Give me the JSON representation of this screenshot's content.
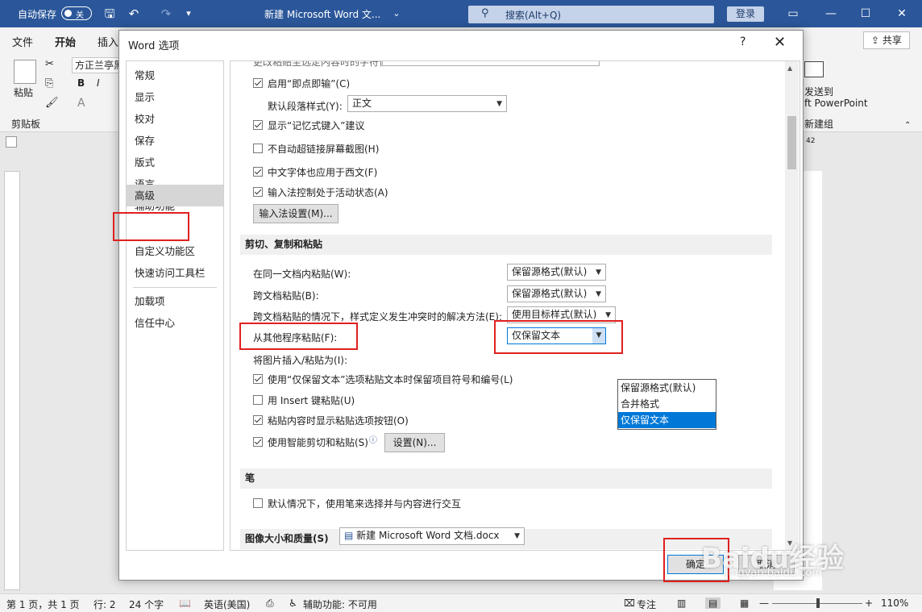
{
  "titlebar": {
    "autosave_label": "自动保存",
    "autosave_state": "关",
    "doc_title": "新建 Microsoft Word 文...",
    "search_placeholder": "搜索(Alt+Q)",
    "login_label": "登录"
  },
  "ribbon": {
    "tabs": [
      "文件",
      "开始",
      "插入"
    ],
    "share_label": "共享",
    "font_name": "方正兰亭黑",
    "paste_label": "粘贴",
    "clipboard_group": "剪贴板",
    "send_to_label": "发送到",
    "ppt_label": "ft PowerPoint",
    "new_group_label": "新建组",
    "ruler_right": "42"
  },
  "dialog": {
    "title": "Word 选项",
    "help": "?",
    "nav": [
      "常规",
      "显示",
      "校对",
      "保存",
      "版式",
      "语言",
      "辅助功能",
      "高级",
      "自定义功能区",
      "快速访问工具栏",
      "加载项",
      "信任中心"
    ],
    "selected_nav": "高级",
    "top_partial_text": "更改粘贴至选定内容时的字符位置",
    "options_top": [
      {
        "label": "启用“即点即输”(C)",
        "checked": true
      },
      {
        "label": "默认段落样式(Y):",
        "value": "正文"
      },
      {
        "label": "显示“记忆式键入”建议",
        "checked": true
      },
      {
        "label": "不自动超链接屏幕截图(H)",
        "checked": false
      },
      {
        "label": "中文字体也应用于西文(F)",
        "checked": true
      },
      {
        "label": "输入法控制处于活动状态(A)",
        "checked": true
      }
    ],
    "ime_button": "输入法设置(M)...",
    "section_paste": "剪切、复制和粘贴",
    "paste_rows": [
      {
        "label": "在同一文档内粘贴(W):",
        "value": "保留源格式(默认)"
      },
      {
        "label": "跨文档粘贴(B):",
        "value": "保留源格式(默认)"
      },
      {
        "label": "跨文档粘贴的情况下，样式定义发生冲突时的解决方法(E):",
        "value": "使用目标样式(默认)"
      },
      {
        "label": "从其他程序粘贴(F):",
        "value": "仅保留文本"
      },
      {
        "label": "将图片插入/粘贴为(I):",
        "value": ""
      }
    ],
    "dropdown_options": [
      "保留源格式(默认)",
      "合并格式",
      "仅保留文本"
    ],
    "dropdown_highlight": "仅保留文本",
    "paste_checks": [
      {
        "label": "使用“仅保留文本”选项粘贴文本时保留项目符号和编号(L)",
        "checked": true
      },
      {
        "label": "用 Insert 键粘贴(U)",
        "checked": false
      },
      {
        "label": "粘贴内容时显示粘贴选项按钮(O)",
        "checked": true
      },
      {
        "label": "使用智能剪切和粘贴(S)",
        "checked": true
      }
    ],
    "settings_button": "设置(N)...",
    "section_pen": "笔",
    "pen_check": {
      "label": "默认情况下，使用笔来选择并与内容进行交互",
      "checked": false
    },
    "section_image": "图像大小和质量(S)",
    "image_doc": "新建 Microsoft Word 文档.docx",
    "ok_label": "确定",
    "cancel_label": "取消"
  },
  "statusbar": {
    "page": "第 1 页，共 1 页",
    "line": "行: 2",
    "words": "24 个字",
    "lang": "英语(美国)",
    "access": "辅助功能: 不可用",
    "focus": "专注",
    "zoom": "110%"
  },
  "watermark": {
    "text": "Baidu经验",
    "sub": "jingyan.baidu.com"
  },
  "colors": {
    "titlebar": "#2b579a",
    "highlight": "#0078d7",
    "annotation": "#e02020"
  }
}
